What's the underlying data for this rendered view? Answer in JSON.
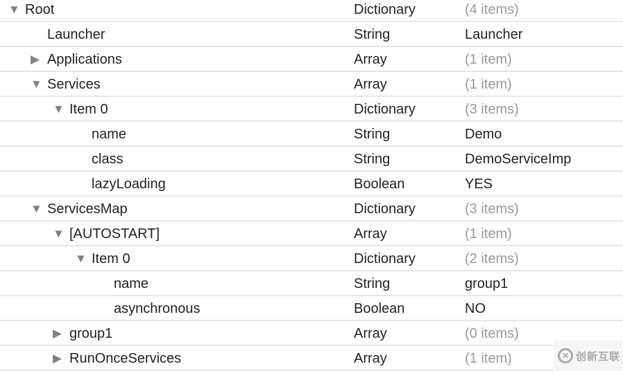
{
  "rows": [
    {
      "key": "Root",
      "type": "Dictionary",
      "value": "(4 items)",
      "level": 0,
      "disclosure": "expanded",
      "count": true
    },
    {
      "key": "Launcher",
      "type": "String",
      "value": "Launcher",
      "level": 1,
      "disclosure": "none",
      "count": false
    },
    {
      "key": "Applications",
      "type": "Array",
      "value": "(1 item)",
      "level": 1,
      "disclosure": "collapsed",
      "count": true
    },
    {
      "key": "Services",
      "type": "Array",
      "value": "(1 item)",
      "level": 1,
      "disclosure": "expanded",
      "count": true
    },
    {
      "key": "Item 0",
      "type": "Dictionary",
      "value": "(3 items)",
      "level": 2,
      "disclosure": "expanded",
      "count": true
    },
    {
      "key": "name",
      "type": "String",
      "value": "Demo",
      "level": 3,
      "disclosure": "none",
      "count": false
    },
    {
      "key": "class",
      "type": "String",
      "value": "DemoServiceImp",
      "level": 3,
      "disclosure": "none",
      "count": false
    },
    {
      "key": "lazyLoading",
      "type": "Boolean",
      "value": "YES",
      "level": 3,
      "disclosure": "none",
      "count": false
    },
    {
      "key": "ServicesMap",
      "type": "Dictionary",
      "value": "(3 items)",
      "level": 1,
      "disclosure": "expanded",
      "count": true
    },
    {
      "key": "[AUTOSTART]",
      "type": "Array",
      "value": "(1 item)",
      "level": 2,
      "disclosure": "expanded",
      "count": true
    },
    {
      "key": "Item 0",
      "type": "Dictionary",
      "value": "(2 items)",
      "level": 3,
      "disclosure": "expanded",
      "count": true
    },
    {
      "key": "name",
      "type": "String",
      "value": "group1",
      "level": 4,
      "disclosure": "none",
      "count": false
    },
    {
      "key": "asynchronous",
      "type": "Boolean",
      "value": "NO",
      "level": 4,
      "disclosure": "none",
      "count": false
    },
    {
      "key": "group1",
      "type": "Array",
      "value": "(0 items)",
      "level": 2,
      "disclosure": "collapsed",
      "count": true
    },
    {
      "key": "RunOnceServices",
      "type": "Array",
      "value": "(1 item)",
      "level": 2,
      "disclosure": "collapsed",
      "count": true
    }
  ],
  "watermark": {
    "text": "创新互联"
  }
}
